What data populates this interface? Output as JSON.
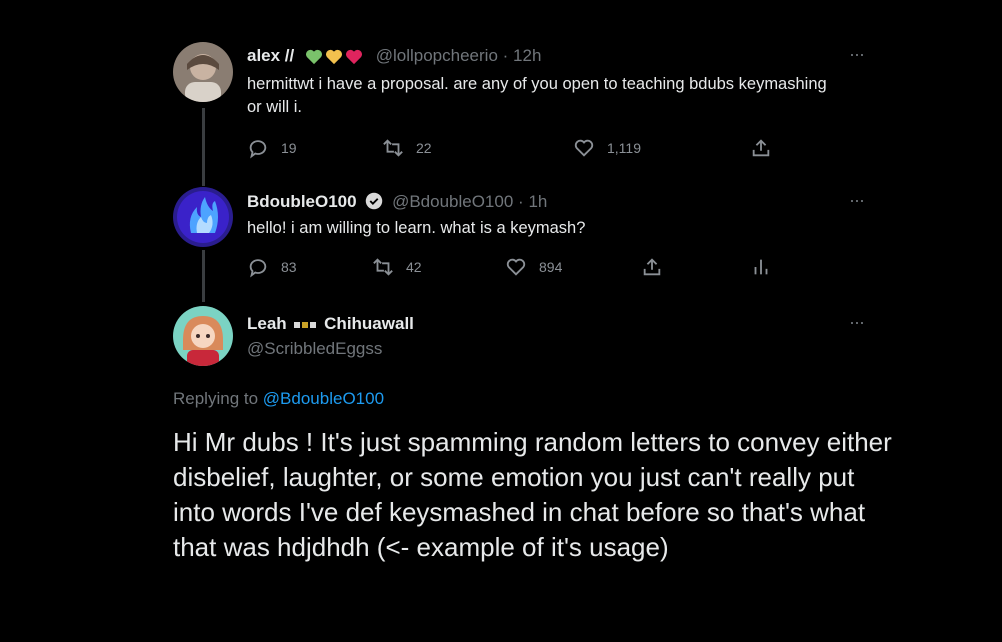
{
  "tweets": [
    {
      "display_name": "alex //",
      "hearts": [
        "#7ac26b",
        "#f2c14e",
        "#e0245e"
      ],
      "handle": "@lollpopcheerio",
      "separator": "·",
      "time": "12h",
      "text": "hermittwt i have a proposal. are any of you open to teaching bdubs keymashing or will i.",
      "replies": "19",
      "retweets": "22",
      "likes": "1,119",
      "more_label": "···"
    },
    {
      "display_name": "BdoubleO100",
      "verified": true,
      "handle": "@BdoubleO100",
      "separator": "·",
      "time": "1h",
      "text": "hello! i am willing to learn.  what is a keymash?",
      "replies": "83",
      "retweets": "42",
      "likes": "894",
      "more_label": "···"
    }
  ],
  "main_tweet": {
    "display_name_first": "Leah",
    "display_name_second": "Chihuawall",
    "handle": "@ScribbledEggss",
    "replying_prefix": "Replying to",
    "replying_to": "@BdoubleO100",
    "text": "Hi Mr dubs ! It's just spamming random letters to convey either disbelief, laughter, or some emotion you just can't really put into words  I've def keysmashed in chat before so that's what that was hdjdhdh (<- example of it's usage)",
    "more_label": "···"
  },
  "colors": {
    "background": "#000000",
    "text": "#e7e9ea",
    "muted": "#71767b",
    "link": "#1d9bf0",
    "verified": "#1d9bf0"
  }
}
